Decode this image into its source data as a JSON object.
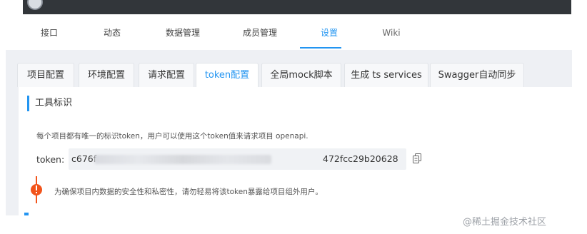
{
  "nav": {
    "items": [
      "接口",
      "动态",
      "数据管理",
      "成员管理",
      "设置",
      "Wiki"
    ]
  },
  "tabs": [
    "项目配置",
    "环境配置",
    "请求配置",
    "token配置",
    "全局mock脚本",
    "生成 ts services",
    "Swagger自动同步"
  ],
  "active_tab": "token配置",
  "section_title": "工具标识",
  "description": "每个项目都有唯一的标识token，用户可以使用这个token值来请求项目 openapi.",
  "token": {
    "label": "token:",
    "visible_start": "c676f",
    "visible_end": "472fcc29b20628"
  },
  "warning_text": "为确保项目内数据的安全性和私密性，请勿轻易将该token暴露给项目组外用户。",
  "watermark": "@稀土掘金技术社区",
  "colors": {
    "accent": "#2395f1",
    "warning": "#f2541b",
    "topbar": "#32363a",
    "panel": "#eef0f4"
  },
  "icons": {
    "copy": "copy-icon",
    "warning": "exclamation-icon"
  }
}
